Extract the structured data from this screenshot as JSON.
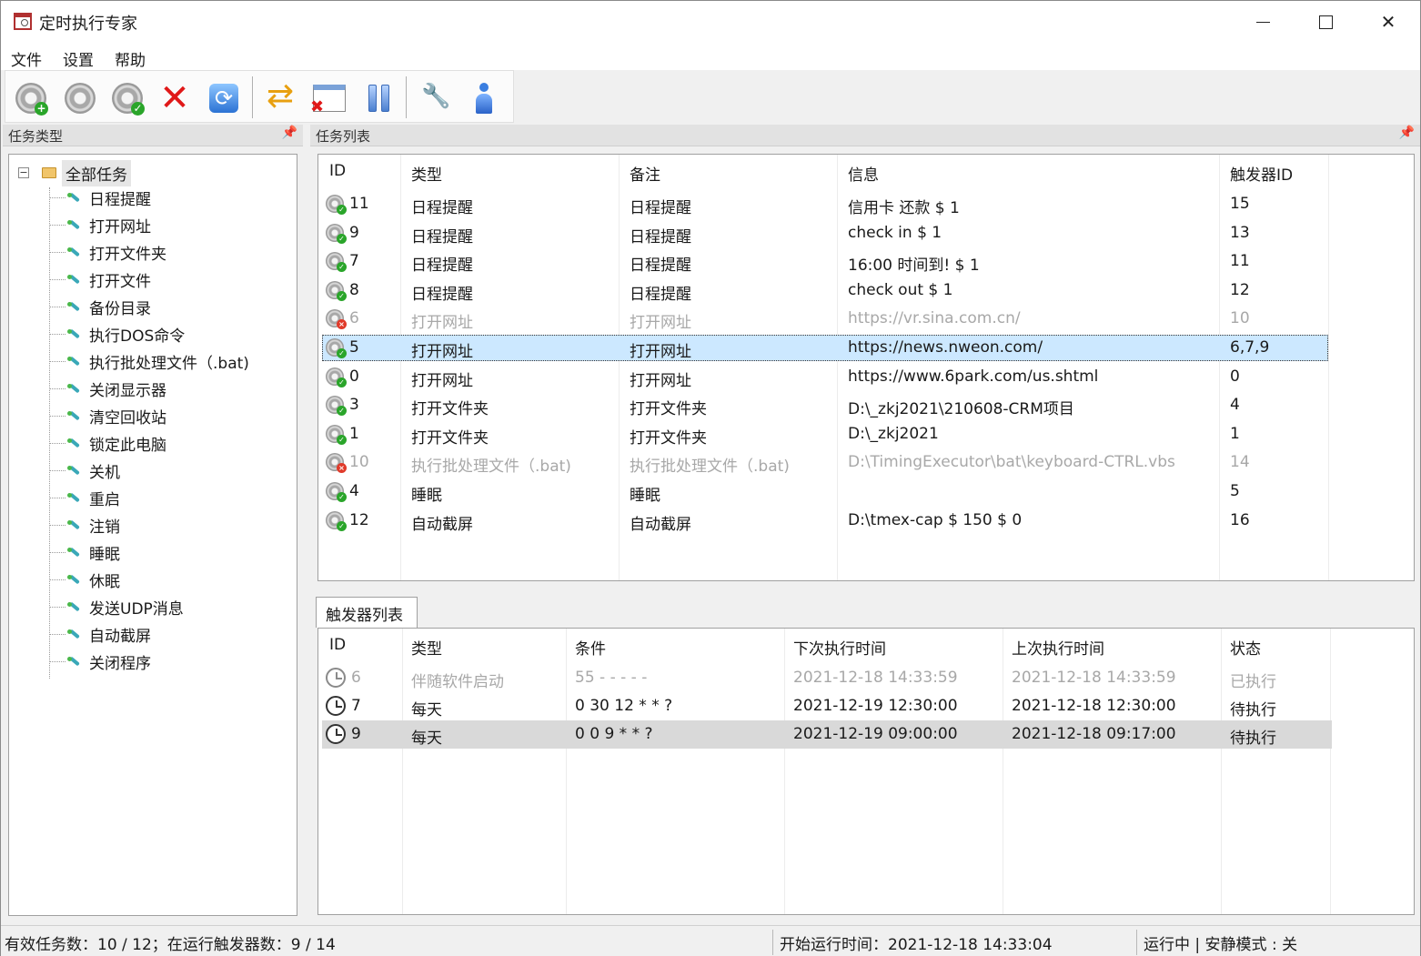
{
  "window": {
    "title": "定时执行专家"
  },
  "menu": [
    "文件",
    "设置",
    "帮助"
  ],
  "toolbar": {
    "buttons": [
      {
        "icon": "gear-add-icon"
      },
      {
        "icon": "gear-icon"
      },
      {
        "icon": "gear-check-icon"
      },
      {
        "icon": "delete-icon"
      },
      {
        "icon": "refresh-icon"
      },
      {
        "icon": "swap-icon"
      },
      {
        "icon": "hide-window-icon"
      },
      {
        "icon": "pause-icon"
      },
      {
        "icon": "tools-icon"
      },
      {
        "icon": "user-icon"
      }
    ]
  },
  "left_panel": {
    "title": "任务类型",
    "root": "全部任务",
    "items": [
      "日程提醒",
      "打开网址",
      "打开文件夹",
      "打开文件",
      "备份目录",
      "执行DOS命令",
      "执行批处理文件（.bat)",
      "关闭显示器",
      "清空回收站",
      "锁定此电脑",
      "关机",
      "重启",
      "注销",
      "睡眠",
      "休眠",
      "发送UDP消息",
      "自动截屏",
      "关闭程序"
    ]
  },
  "task_panel": {
    "title": "任务列表",
    "columns": [
      "ID",
      "类型",
      "备注",
      "信息",
      "触发器ID"
    ],
    "rows": [
      {
        "id": "11",
        "type": "日程提醒",
        "note": "日程提醒",
        "info": "信用卡 还款 $ 1",
        "trigger": "15",
        "status": "ok"
      },
      {
        "id": "9",
        "type": "日程提醒",
        "note": "日程提醒",
        "info": "check in $ 1",
        "trigger": "13",
        "status": "ok"
      },
      {
        "id": "7",
        "type": "日程提醒",
        "note": "日程提醒",
        "info": "16:00 时间到!  $ 1",
        "trigger": "11",
        "status": "ok"
      },
      {
        "id": "8",
        "type": "日程提醒",
        "note": "日程提醒",
        "info": "check out $ 1",
        "trigger": "12",
        "status": "ok"
      },
      {
        "id": "6",
        "type": "打开网址",
        "note": "打开网址",
        "info": "https://vr.sina.com.cn/",
        "trigger": "10",
        "status": "err"
      },
      {
        "id": "5",
        "type": "打开网址",
        "note": "打开网址",
        "info": "https://news.nweon.com/",
        "trigger": "6,7,9",
        "status": "ok"
      },
      {
        "id": "0",
        "type": "打开网址",
        "note": "打开网址",
        "info": "https://www.6park.com/us.shtml",
        "trigger": "0",
        "status": "ok"
      },
      {
        "id": "3",
        "type": "打开文件夹",
        "note": "打开文件夹",
        "info": "D:\\_zkj2021\\210608-CRM项目",
        "trigger": "4",
        "status": "ok"
      },
      {
        "id": "1",
        "type": "打开文件夹",
        "note": "打开文件夹",
        "info": "D:\\_zkj2021",
        "trigger": "1",
        "status": "ok"
      },
      {
        "id": "10",
        "type": "执行批处理文件（.bat)",
        "note": "执行批处理文件（.bat)",
        "info": "D:\\TimingExecutor\\bat\\keyboard-CTRL.vbs",
        "trigger": "14",
        "status": "err"
      },
      {
        "id": "4",
        "type": "睡眠",
        "note": "睡眠",
        "info": "",
        "trigger": "5",
        "status": "ok"
      },
      {
        "id": "12",
        "type": "自动截屏",
        "note": "自动截屏",
        "info": "D:\\tmex-cap $ 150 $ 0",
        "trigger": "16",
        "status": "ok"
      }
    ]
  },
  "trigger_panel": {
    "tab": "触发器列表",
    "columns": [
      "ID",
      "类型",
      "条件",
      "下次执行时间",
      "上次执行时间",
      "状态"
    ],
    "rows": [
      {
        "id": "6",
        "type": "伴随软件启动",
        "cond": "55 - - - - -",
        "next": "2021-12-18 14:33:59",
        "last": "2021-12-18 14:33:59",
        "state": "已执行",
        "faded": true
      },
      {
        "id": "7",
        "type": "每天",
        "cond": "0 30 12 * * ?",
        "next": "2021-12-19 12:30:00",
        "last": "2021-12-18 12:30:00",
        "state": "待执行",
        "faded": false
      },
      {
        "id": "9",
        "type": "每天",
        "cond": "0 0 9 * * ?",
        "next": "2021-12-19 09:00:00",
        "last": "2021-12-18 09:17:00",
        "state": "待执行",
        "faded": false
      }
    ]
  },
  "statusbar": {
    "left": "有效任务数：10 / 12；在运行触发器数：9 / 14",
    "middle": "开始运行时间：2021-12-18 14:33:04",
    "right": "运行中 | 安静模式 : 关"
  }
}
